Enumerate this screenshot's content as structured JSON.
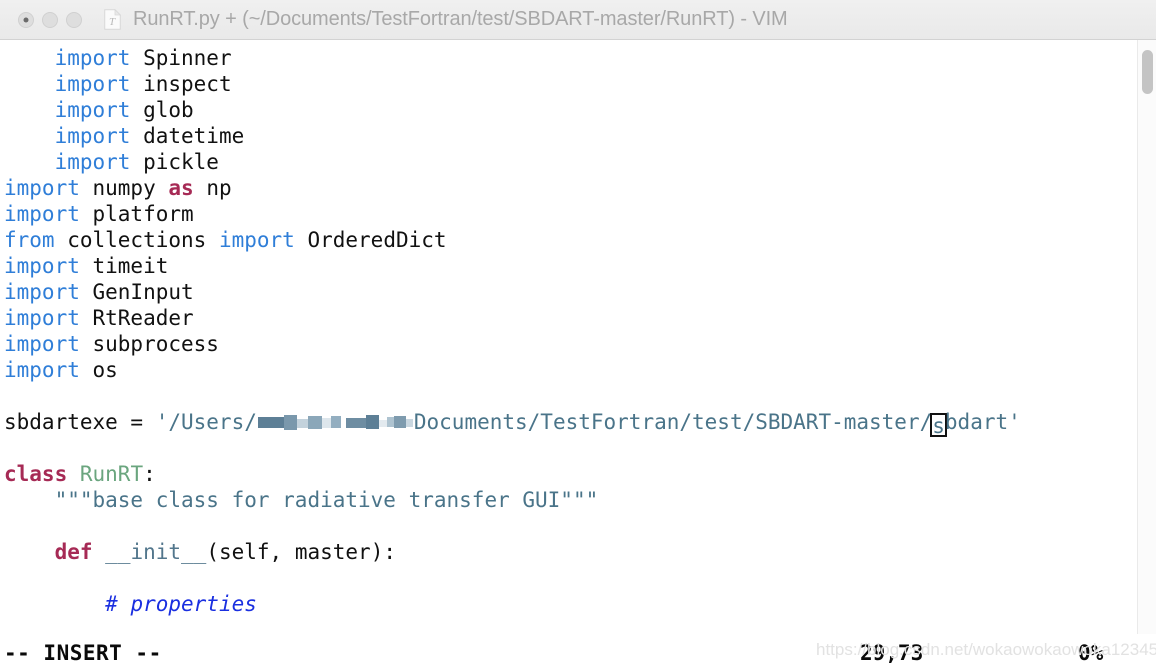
{
  "window": {
    "title": "RunRT.py + (~/Documents/TestFortran/test/SBDART-master/RunRT) - VIM",
    "file_icon": "python-file-icon",
    "traffic_lights": [
      {
        "name": "close-button",
        "label": ""
      },
      {
        "name": "minimize-button",
        "label": ""
      },
      {
        "name": "maximize-button",
        "label": ""
      }
    ]
  },
  "editor": {
    "lines": [
      {
        "indent": "    ",
        "tokens": [
          {
            "t": "import",
            "c": "kw-import"
          },
          {
            "t": " Spinner",
            "c": "plain"
          }
        ]
      },
      {
        "indent": "    ",
        "tokens": [
          {
            "t": "import",
            "c": "kw-import"
          },
          {
            "t": " inspect",
            "c": "plain"
          }
        ]
      },
      {
        "indent": "    ",
        "tokens": [
          {
            "t": "import",
            "c": "kw-import"
          },
          {
            "t": " glob",
            "c": "plain"
          }
        ]
      },
      {
        "indent": "    ",
        "tokens": [
          {
            "t": "import",
            "c": "kw-import"
          },
          {
            "t": " datetime",
            "c": "plain"
          }
        ]
      },
      {
        "indent": "    ",
        "tokens": [
          {
            "t": "import",
            "c": "kw-import"
          },
          {
            "t": " pickle",
            "c": "plain"
          }
        ]
      },
      {
        "indent": "",
        "tokens": [
          {
            "t": "import",
            "c": "kw-import"
          },
          {
            "t": " numpy ",
            "c": "plain"
          },
          {
            "t": "as",
            "c": "kw-as"
          },
          {
            "t": " np",
            "c": "plain"
          }
        ]
      },
      {
        "indent": "",
        "tokens": [
          {
            "t": "import",
            "c": "kw-import"
          },
          {
            "t": " platform",
            "c": "plain"
          }
        ]
      },
      {
        "indent": "",
        "tokens": [
          {
            "t": "from",
            "c": "kw-import"
          },
          {
            "t": " collections ",
            "c": "plain"
          },
          {
            "t": "import",
            "c": "kw-import"
          },
          {
            "t": " OrderedDict",
            "c": "plain"
          }
        ]
      },
      {
        "indent": "",
        "tokens": [
          {
            "t": "import",
            "c": "kw-import"
          },
          {
            "t": " timeit",
            "c": "plain"
          }
        ]
      },
      {
        "indent": "",
        "tokens": [
          {
            "t": "import",
            "c": "kw-import"
          },
          {
            "t": " GenInput",
            "c": "plain"
          }
        ]
      },
      {
        "indent": "",
        "tokens": [
          {
            "t": "import",
            "c": "kw-import"
          },
          {
            "t": " RtReader",
            "c": "plain"
          }
        ]
      },
      {
        "indent": "",
        "tokens": [
          {
            "t": "import",
            "c": "kw-import"
          },
          {
            "t": " subprocess",
            "c": "plain"
          }
        ]
      },
      {
        "indent": "",
        "tokens": [
          {
            "t": "import",
            "c": "kw-import"
          },
          {
            "t": " os",
            "c": "plain"
          }
        ]
      },
      {
        "indent": "",
        "tokens": []
      },
      {
        "indent": "",
        "special": "sbdartexe"
      },
      {
        "indent": "",
        "tokens": []
      },
      {
        "indent": "",
        "tokens": [
          {
            "t": "class",
            "c": "kw-class"
          },
          {
            "t": " ",
            "c": "plain"
          },
          {
            "t": "RunRT",
            "c": "cls-name"
          },
          {
            "t": ":",
            "c": "plain"
          }
        ]
      },
      {
        "indent": "    ",
        "tokens": [
          {
            "t": "\"\"\"base class for radiative transfer GUI\"\"\"",
            "c": "docstr"
          }
        ]
      },
      {
        "indent": "",
        "tokens": []
      },
      {
        "indent": "    ",
        "tokens": [
          {
            "t": "def",
            "c": "kw-def"
          },
          {
            "t": " ",
            "c": "plain"
          },
          {
            "t": "__init__",
            "c": "fn-name"
          },
          {
            "t": "(self, master):",
            "c": "plain"
          }
        ]
      },
      {
        "indent": "",
        "tokens": []
      },
      {
        "indent": "        ",
        "tokens": [
          {
            "t": "# properties",
            "c": "comment"
          }
        ]
      }
    ],
    "sbdartexe_line": {
      "variable": "sbdartexe",
      "operator": " = ",
      "string_prefix": "'/Users/",
      "redacted_username": "",
      "string_middle": "Documents/TestFortran/test/SBDART-master/",
      "cursor_char": "s",
      "string_suffix": "bdart'"
    }
  },
  "scrollbar": {
    "name": "vertical-scrollbar",
    "thumb_name": "scrollbar-thumb"
  },
  "statusbar": {
    "mode": "-- INSERT --",
    "position": "29,73",
    "percent": "0%"
  },
  "watermark": {
    "text": "https://blog.csdn.net/wokaowokaowoka12345"
  },
  "colors": {
    "keyword": "#a62a55",
    "import": "#2f7ed8",
    "string": "#4a7489",
    "comment": "#1a2fe0",
    "class_name": "#6aa57e",
    "function_name": "#52768c",
    "background": "#ffffff",
    "titlebar": "#eeeeee",
    "title_text": "#a8a8a8"
  }
}
